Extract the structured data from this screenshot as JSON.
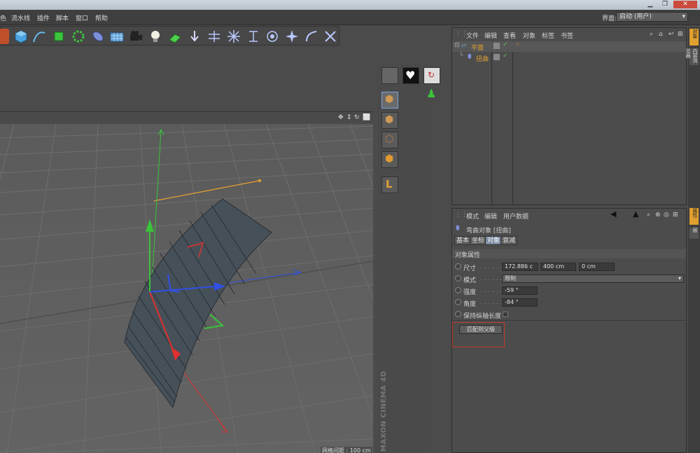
{
  "menubar": {
    "items": [
      "色",
      "流水线",
      "插件",
      "脚本",
      "窗口",
      "帮助"
    ],
    "layout_label": "界面:",
    "layout_value": "启动 (用户)"
  },
  "toolbar": {
    "icons": [
      "cube-icon",
      "spline-icon",
      "nurbs-icon",
      "array-icon",
      "deformer-icon",
      "floor-icon",
      "camera-icon",
      "light-icon",
      "spread-icon",
      "arrow-down-icon",
      "split-icon",
      "burst-icon",
      "bracket-icon",
      "circle-target-icon",
      "star-icon",
      "bend-icon",
      "cross-icon"
    ]
  },
  "viewport": {
    "status_text": "网格间距 : 100 cm",
    "colors": {
      "x_axis": "#e03030",
      "y_axis": "#3ac43a",
      "z_axis": "#3050e8",
      "guide": "#e8a030"
    }
  },
  "brand": {
    "text": "MAXON CINEMA 4D"
  },
  "object_manager": {
    "menus": [
      "文件",
      "编辑",
      "查看",
      "对象",
      "标签",
      "书签"
    ],
    "objects": [
      {
        "name": "平面",
        "color": "#e0a030"
      },
      {
        "name": "扭曲",
        "color": "#e0a030"
      }
    ]
  },
  "attribute_manager": {
    "menus": [
      "模式",
      "编辑",
      "用户数据"
    ],
    "object_title": "弯曲对象 [扭曲]",
    "tabs": [
      {
        "label": "基本",
        "active": false
      },
      {
        "label": "坐标",
        "active": false
      },
      {
        "label": "对象",
        "active": true
      },
      {
        "label": "衰减",
        "active": false
      }
    ],
    "section_title": "对象属性",
    "props": {
      "size": {
        "label": "尺寸",
        "values": [
          "172.886 c",
          "400 cm",
          "0 cm"
        ]
      },
      "mode": {
        "label": "模式",
        "value": "限制"
      },
      "strength": {
        "label": "强度",
        "value": "-59 °"
      },
      "angle": {
        "label": "角度",
        "value": "-84 °"
      },
      "keep_length": {
        "label": "保持纵轴长度"
      }
    },
    "fit_button": "匹配到父级"
  },
  "side_tabs": [
    "对象",
    "内容浏览器",
    "属性",
    "层"
  ]
}
